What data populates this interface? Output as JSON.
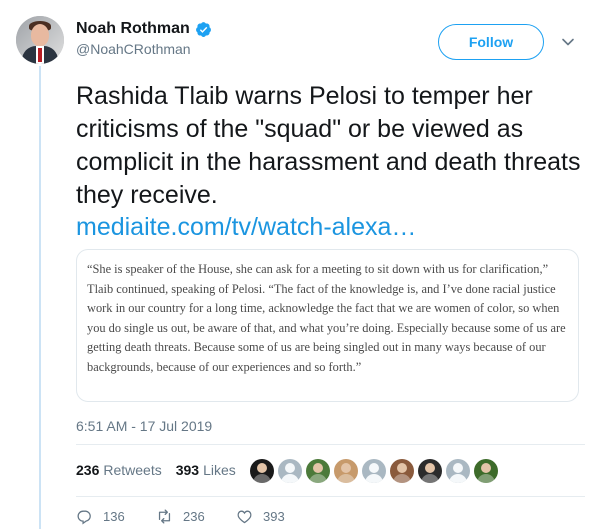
{
  "author": {
    "display_name": "Noah Rothman",
    "handle": "@NoahCRothman",
    "verified_icon": "verified-badge-icon",
    "avatar_icon": "profile-photo"
  },
  "header": {
    "follow_label": "Follow",
    "menu_icon": "chevron-down-icon"
  },
  "tweet": {
    "text": "Rashida Tlaib warns Pelosi to temper her criticisms of the \"squad\" or be viewed as complicit in the harassment and death threats they receive.",
    "link_text": "mediaite.com/tv/watch-alexa…"
  },
  "quote_card": {
    "text": "“She is speaker of the House, she can ask for a meeting to sit down with us for clarification,” Tlaib continued, speaking of Pelosi. “The fact of the knowledge is, and I’ve done racial justice work in our country for a long time, acknowledge the fact that we are women of color, so when you do single us out, be aware of that, and what you’re doing. Especially because some of us are getting death threats. Because some of us are being singled out in many ways because of our backgrounds, because of our experiences and so forth.”"
  },
  "timestamp": "6:51 AM - 17 Jul 2019",
  "stats": {
    "retweets_count": "236",
    "retweets_label": "Retweets",
    "likes_count": "393",
    "likes_label": "Likes"
  },
  "likers": [
    {
      "icon": "raiders-logo-avatar",
      "color": "#1a1a1a"
    },
    {
      "icon": "default-avatar",
      "color": "#aab8c2"
    },
    {
      "icon": "photo-avatar",
      "color": "#4c7a3a"
    },
    {
      "icon": "photo-avatar",
      "color": "#c79a6b"
    },
    {
      "icon": "default-avatar",
      "color": "#aab8c2"
    },
    {
      "icon": "photo-avatar",
      "color": "#8a5a3c"
    },
    {
      "icon": "photo-avatar",
      "color": "#2b2b2b"
    },
    {
      "icon": "default-avatar",
      "color": "#aab8c2"
    },
    {
      "icon": "photo-avatar",
      "color": "#3d6b2a"
    }
  ],
  "actions": {
    "replies": "136",
    "retweets": "236",
    "likes": "393"
  },
  "colors": {
    "accent": "#1da1f2",
    "link": "#1b95e0",
    "muted": "#657786",
    "thread_line": "#cce3f5"
  }
}
